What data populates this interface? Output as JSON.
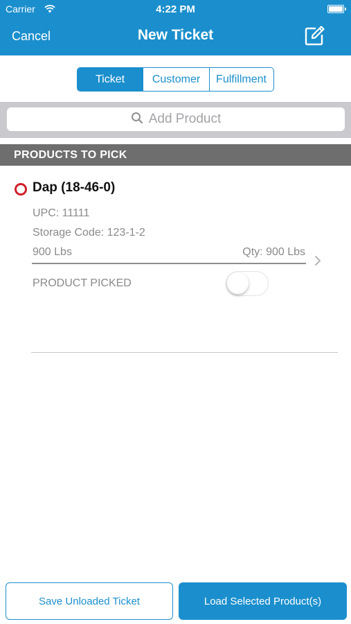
{
  "status_bar": {
    "carrier": "Carrier",
    "time": "4:22 PM"
  },
  "navbar": {
    "cancel_label": "Cancel",
    "title": "New Ticket",
    "edit_icon": "compose-icon"
  },
  "segments": {
    "items": [
      {
        "label": "Ticket",
        "selected": true
      },
      {
        "label": "Customer",
        "selected": false
      },
      {
        "label": "Fulfillment",
        "selected": false
      }
    ]
  },
  "search": {
    "placeholder": "Add Product",
    "icon": "search-icon"
  },
  "section": {
    "title": "PRODUCTS TO PICK"
  },
  "product": {
    "name": "Dap (18-46-0)",
    "upc": "UPC: 11111",
    "storage_code": "Storage Code: 123-1-2",
    "weight": "900  Lbs",
    "qty": "Qty: 900 Lbs",
    "picked_label": "PRODUCT PICKED",
    "picked": false
  },
  "footer": {
    "save_label": "Save Unloaded Ticket",
    "load_label": "Load Selected Product(s)"
  },
  "colors": {
    "brand_blue": "#1b8fcd",
    "header_gray": "#6e6e6e",
    "unpicked_red": "#d0202a"
  }
}
